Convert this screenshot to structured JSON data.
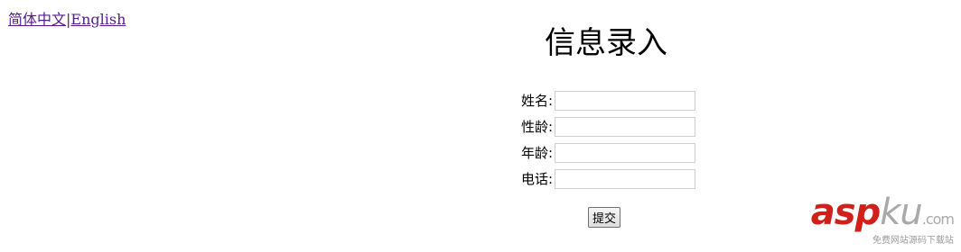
{
  "language_bar": {
    "chinese_label": "简体中文",
    "separator": "|",
    "english_label": "English"
  },
  "form": {
    "title": "信息录入",
    "fields": [
      {
        "label": "姓名:",
        "value": ""
      },
      {
        "label": "性龄:",
        "value": ""
      },
      {
        "label": "年龄:",
        "value": ""
      },
      {
        "label": "电话:",
        "value": ""
      }
    ],
    "submit_label": "提交"
  },
  "watermark": {
    "brand_asp": "asp",
    "brand_ku": "ku",
    "brand_suffix": ".com",
    "tagline": "免费网站源码下载站"
  },
  "colors": {
    "link_visited": "#551a8b",
    "brand_red": "#d0201a",
    "brand_gray": "#a9a9a9"
  }
}
